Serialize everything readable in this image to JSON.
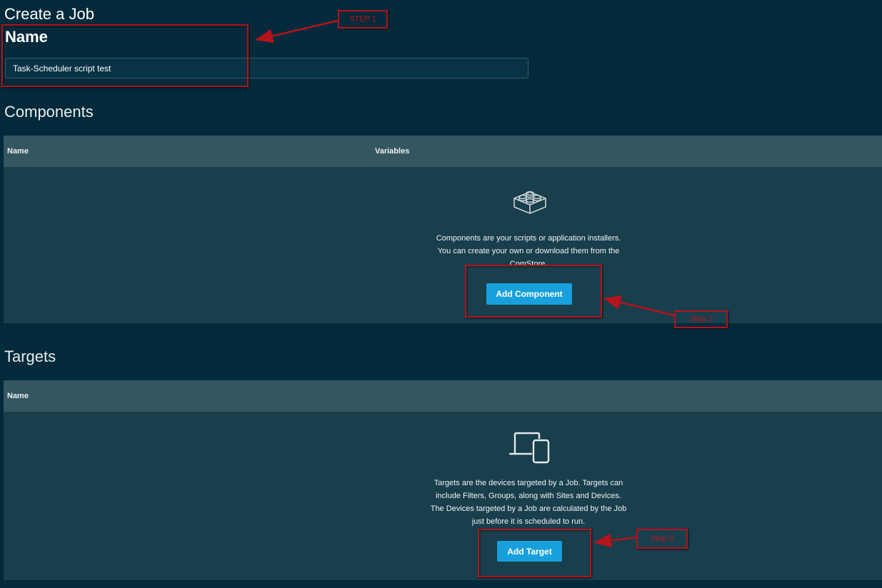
{
  "page": {
    "title": "Create a Job"
  },
  "name_section": {
    "heading": "Name",
    "input_value": "Task-Scheduler script test"
  },
  "components": {
    "heading": "Components",
    "columns": [
      "Name",
      "Variables"
    ],
    "icon": "component-block-icon",
    "empty_text": [
      "Components are your scripts or application installers.",
      "You can create your own or download them from the",
      "ComStore."
    ],
    "button_label": "Add Component"
  },
  "targets": {
    "heading": "Targets",
    "columns": [
      "Name"
    ],
    "icon": "laptop-phone-icon",
    "empty_text": [
      "Targets are the devices targeted by a Job. Targets can",
      "include Filters, Groups, along with Sites and Devices.",
      "The Devices targeted by a Job are calculated by the Job",
      "just before it is scheduled to run."
    ],
    "button_label": "Add Target"
  },
  "annotations": {
    "step1": "STEP 1",
    "step2": "Step 2",
    "step3": "Step 3",
    "color": "#b4141c"
  },
  "colors": {
    "background": "#022a3a",
    "table_header": "#345660",
    "table_body": "#193e4c",
    "button": "#18a0dc"
  }
}
